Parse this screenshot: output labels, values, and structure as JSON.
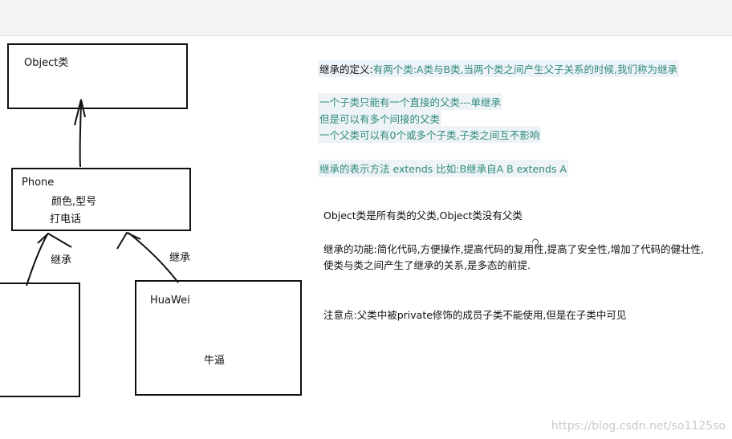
{
  "diagram": {
    "object_box": {
      "title": "Object类"
    },
    "phone_box": {
      "title": "Phone",
      "attributes": "颜色,型号",
      "method": "打电话"
    },
    "huawei_box": {
      "title": "HuaWei",
      "note": "牛逼"
    },
    "inherit_label_left": "继承",
    "inherit_label_right": "继承"
  },
  "notes": {
    "def_prefix": "继承的定义:",
    "def_body": "有两个类:A类与B类,当两个类之间产生父子关系的时候,我们称为继承",
    "single_inherit": "一个子类只能有一个直接的父类---单继承",
    "indirect_parents": "但是可以有多个间接的父类",
    "multi_children": "一个父类可以有0个或多个子类,子类之间互不影响",
    "syntax": "继承的表示方法  extends   比如:B继承自A  B  extends A",
    "object_root": "Object类是所有类的父类,Object类没有父类",
    "benefits_1": "继承的功能:简化代码,方便操作,提高代码的复用性,提高了安全性,增加了代码的健壮性,",
    "benefits_2": "使类与类之间产生了继承的关系,是多态的前提.",
    "caution": "注意点:父类中被private修饰的成员子类不能使用,但是在子类中可见"
  },
  "watermark": "https://blog.csdn.net/so1125so",
  "colors": {
    "teal_text": "#2f8b78",
    "highlight_bg": "#eef3f8"
  }
}
